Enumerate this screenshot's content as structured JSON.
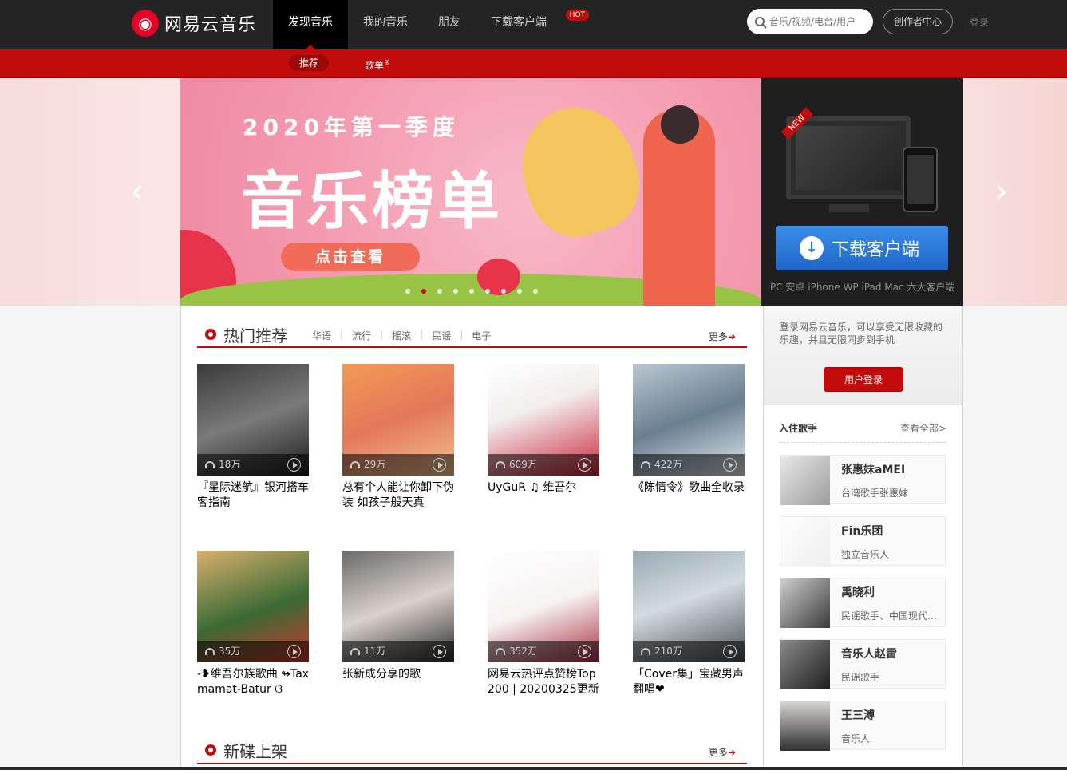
{
  "header": {
    "logo_mark": "◉",
    "logo_text": "网易云音乐",
    "nav": [
      {
        "label": "发现音乐"
      },
      {
        "label": "我的音乐"
      },
      {
        "label": "朋友"
      },
      {
        "label": "下载客户端",
        "badge": "HOT"
      }
    ],
    "search_placeholder": "音乐/视频/电台/用户",
    "creator_label": "创作者中心",
    "login_label": "登录"
  },
  "subnav": {
    "items": [
      {
        "label": "推荐"
      },
      {
        "label": "歌单"
      }
    ],
    "playlist_mark": "®"
  },
  "banner": {
    "subtitle": "2020年第一季度",
    "title": "音乐榜单",
    "button": "点击查看",
    "dot_count": 9,
    "active_dot": 1,
    "prev_arrow": "‹",
    "next_arrow": "›"
  },
  "download_panel": {
    "new_tag": "NEW",
    "button_icon": "↓",
    "button_label": "下载客户端",
    "platforms": "PC 安卓 iPhone WP iPad Mac 六大客户端"
  },
  "hot": {
    "title": "热门推荐",
    "tags": [
      "华语",
      "流行",
      "摇滚",
      "民谣",
      "电子"
    ],
    "more": "更多",
    "more_arrow": "➜",
    "playlists": [
      {
        "title": "『星际迷航』银河搭车客指南",
        "plays": "18万"
      },
      {
        "title": "总有个人能让你卸下伪装 如孩子般天真",
        "plays": "29万"
      },
      {
        "title": "UyGuR ♫ 维吾尔",
        "plays": "609万"
      },
      {
        "title": "《陈情令》歌曲全收录",
        "plays": "422万"
      },
      {
        "title": "-❥维吾尔族歌曲 ↬Taxmamat-Batur ଓ",
        "plays": "35万"
      },
      {
        "title": "张新成分享的歌",
        "plays": "11万"
      },
      {
        "title": "网易云热评点赞榜Top200 | 20200325更新",
        "plays": "352万"
      },
      {
        "title": "「Cover集」宝藏男声翻唱❤",
        "plays": "210万"
      }
    ]
  },
  "new_albums": {
    "title": "新碟上架",
    "more": "更多",
    "more_arrow": "➜"
  },
  "sidebar": {
    "login_text": "登录网易云音乐，可以享受无限收藏的乐趣，并且无限同步到手机",
    "login_button": "用户登录",
    "singers_title": "入住歌手",
    "singers_all": "查看全部>",
    "singers": [
      {
        "name": "张惠妹aMEI",
        "desc": "台湾歌手张惠妹"
      },
      {
        "name": "Fin乐团",
        "desc": "独立音乐人"
      },
      {
        "name": "禹晓利",
        "desc": "民谣歌手、中国现代歌..."
      },
      {
        "name": "音乐人赵雷",
        "desc": "民谣歌手"
      },
      {
        "name": "王三溥",
        "desc": "音乐人"
      }
    ]
  },
  "colors": {
    "brand_red": "#c20c0c",
    "topbar": "#242424",
    "download_blue": "#2374d5"
  }
}
